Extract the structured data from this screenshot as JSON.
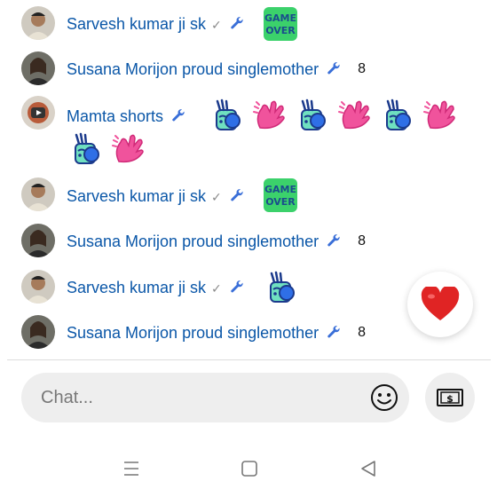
{
  "messages": [
    {
      "author": "Sarvesh kumar ji sk",
      "verified": "✓",
      "moderator_icon": "wrench-icon",
      "content": "sticker-game-over",
      "avatar": "man-avatar"
    },
    {
      "author": "Susana Morijon proud singlemother",
      "verified": "",
      "moderator_icon": "wrench-icon",
      "text": "8",
      "avatar": "woman-avatar"
    },
    {
      "author": "Mamta shorts",
      "verified": "",
      "moderator_icon": "wrench-icon",
      "content": "sticker-waving-hand x4 + sticker-heart-hand x4",
      "avatar": "channel-avatar"
    },
    {
      "author": "Sarvesh kumar ji sk",
      "verified": "✓",
      "moderator_icon": "wrench-icon",
      "content": "sticker-game-over",
      "avatar": "man-avatar"
    },
    {
      "author": "Susana Morijon proud singlemother",
      "verified": "",
      "moderator_icon": "wrench-icon",
      "text": "8",
      "avatar": "woman-avatar"
    },
    {
      "author": "Sarvesh kumar ji sk",
      "verified": "✓",
      "moderator_icon": "wrench-icon",
      "content": "sticker-waving-hand",
      "avatar": "man-avatar"
    },
    {
      "author": "Susana Morijon proud singlemother",
      "verified": "",
      "moderator_icon": "wrench-icon",
      "text": "8",
      "avatar": "woman-avatar"
    }
  ],
  "chat": {
    "placeholder": "Chat..."
  },
  "colors": {
    "name": "#0b57a8",
    "wrench": "#3a6fd8",
    "heart": "#e02424",
    "input_bg": "#eeeeee"
  },
  "icons": {
    "heart": "heart-icon",
    "emoji": "smiley-icon",
    "super_chat": "dollar-bill-icon",
    "nav": [
      "menu-icon",
      "home-square-icon",
      "back-triangle-icon"
    ]
  }
}
